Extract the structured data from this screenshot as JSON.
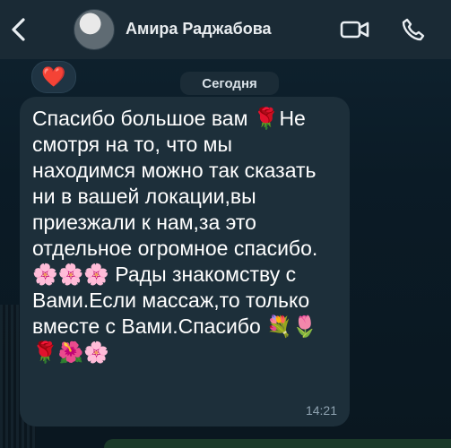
{
  "header": {
    "contact_name": "Амира Раджабова",
    "back_icon": "chevron-left-icon",
    "video_icon": "video-camera-icon",
    "call_icon": "phone-icon"
  },
  "reaction": {
    "emoji": "❤️"
  },
  "date_separator": "Сегодня",
  "message": {
    "text": "Спасибо большое вам 🌹Не смотря на то, что мы находимся можно так сказать ни в вашей локации,вы приезжали к нам,за это отдельное огромное спасибо. 🌸🌸🌸 Рады знакомству с Вами.Если массаж,то только вместе с Вами.Спасибо 💐🌷 🌹🌺🌸",
    "time": "14:21"
  }
}
